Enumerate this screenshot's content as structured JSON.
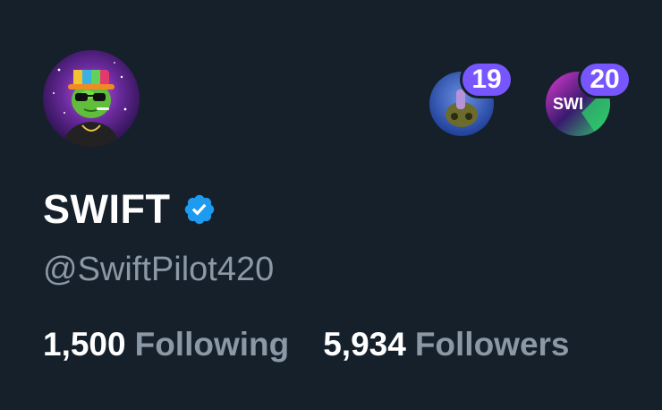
{
  "profile": {
    "display_name": "SWIFT",
    "handle": "@SwiftPilot420",
    "verified": true,
    "avatar_icon": "weed-character-avatar",
    "stats": {
      "following_count": "1,500",
      "following_label": "Following",
      "followers_count": "5,934",
      "followers_label": "Followers"
    }
  },
  "accounts": [
    {
      "badge": "19",
      "avatar_icon": "character-avatar"
    },
    {
      "badge": "20",
      "avatar_icon": "swift-logo-avatar"
    }
  ],
  "colors": {
    "background": "#15202b",
    "text_primary": "#ffffff",
    "text_secondary": "#8b98a5",
    "verified_blue": "#1d9bf0",
    "badge_purple": "#7856ff"
  }
}
